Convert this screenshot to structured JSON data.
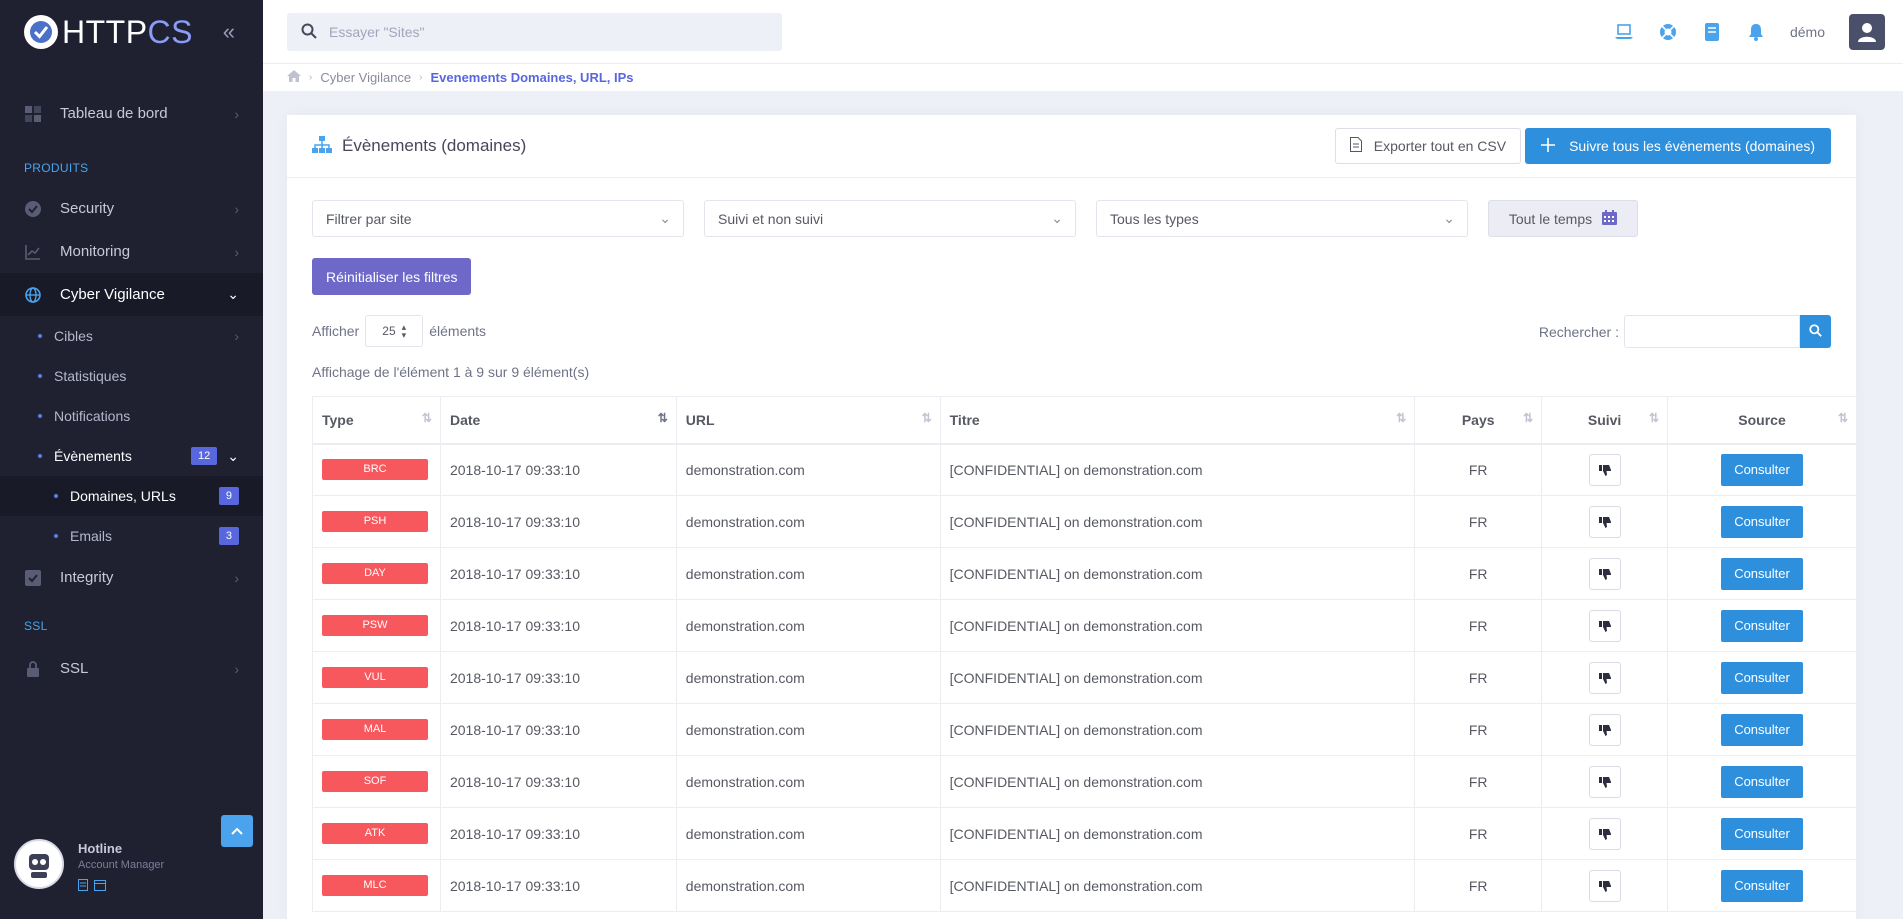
{
  "brand": {
    "name_prefix": "HTTP",
    "name_suffix": "CS"
  },
  "sidebar": {
    "dashboard": "Tableau de bord",
    "section_products": "PRODUITS",
    "security": "Security",
    "monitoring": "Monitoring",
    "cyber": "Cyber Vigilance",
    "cibles": "Cibles",
    "statistiques": "Statistiques",
    "notifications": "Notifications",
    "evenements": "Évènements",
    "evenements_count": "12",
    "domaines": "Domaines, URLs",
    "domaines_count": "9",
    "emails": "Emails",
    "emails_count": "3",
    "integrity": "Integrity",
    "section_ssl": "SSL",
    "ssl": "SSL",
    "hotline": "Hotline",
    "account_manager": "Account Manager"
  },
  "topbar": {
    "search_placeholder": "Essayer \"Sites\"",
    "user": "démo"
  },
  "breadcrumb": {
    "item1": "Cyber Vigilance",
    "current": "Evenements Domaines, URL, IPs"
  },
  "card": {
    "title": "Évènements (domaines)",
    "export_label": "Exporter tout en CSV",
    "follow_all_label": "Suivre tous les évènements (domaines)"
  },
  "filters": {
    "site": "Filtrer par site",
    "suivi": "Suivi et non suivi",
    "types": "Tous les types",
    "time": "Tout le temps",
    "reset": "Réinitialiser les filtres"
  },
  "table_controls": {
    "show_label": "Afficher",
    "page_size": "25",
    "elements_label": "éléments",
    "search_label": "Rechercher :",
    "info": "Affichage de l'élément 1 à 9 sur 9 élément(s)"
  },
  "table": {
    "headers": [
      "Type",
      "Date",
      "URL",
      "Titre",
      "Pays",
      "Suivi",
      "Source"
    ],
    "consult_label": "Consulter",
    "rows": [
      {
        "type": "BRC",
        "date": "2018-10-17 09:33:10",
        "url": "demonstration.com",
        "title": "[CONFIDENTIAL] on demonstration.com",
        "country": "FR"
      },
      {
        "type": "PSH",
        "date": "2018-10-17 09:33:10",
        "url": "demonstration.com",
        "title": "[CONFIDENTIAL] on demonstration.com",
        "country": "FR"
      },
      {
        "type": "DAY",
        "date": "2018-10-17 09:33:10",
        "url": "demonstration.com",
        "title": "[CONFIDENTIAL] on demonstration.com",
        "country": "FR"
      },
      {
        "type": "PSW",
        "date": "2018-10-17 09:33:10",
        "url": "demonstration.com",
        "title": "[CONFIDENTIAL] on demonstration.com",
        "country": "FR"
      },
      {
        "type": "VUL",
        "date": "2018-10-17 09:33:10",
        "url": "demonstration.com",
        "title": "[CONFIDENTIAL] on demonstration.com",
        "country": "FR"
      },
      {
        "type": "MAL",
        "date": "2018-10-17 09:33:10",
        "url": "demonstration.com",
        "title": "[CONFIDENTIAL] on demonstration.com",
        "country": "FR"
      },
      {
        "type": "SOF",
        "date": "2018-10-17 09:33:10",
        "url": "demonstration.com",
        "title": "[CONFIDENTIAL] on demonstration.com",
        "country": "FR"
      },
      {
        "type": "ATK",
        "date": "2018-10-17 09:33:10",
        "url": "demonstration.com",
        "title": "[CONFIDENTIAL] on demonstration.com",
        "country": "FR"
      },
      {
        "type": "MLC",
        "date": "2018-10-17 09:33:10",
        "url": "demonstration.com",
        "title": "[CONFIDENTIAL] on demonstration.com",
        "country": "FR"
      }
    ]
  },
  "colors": {
    "accent": "#2e8fdc",
    "badge": "#f7585d",
    "sidebar": "#1f2131",
    "reset": "#6e68c8"
  }
}
